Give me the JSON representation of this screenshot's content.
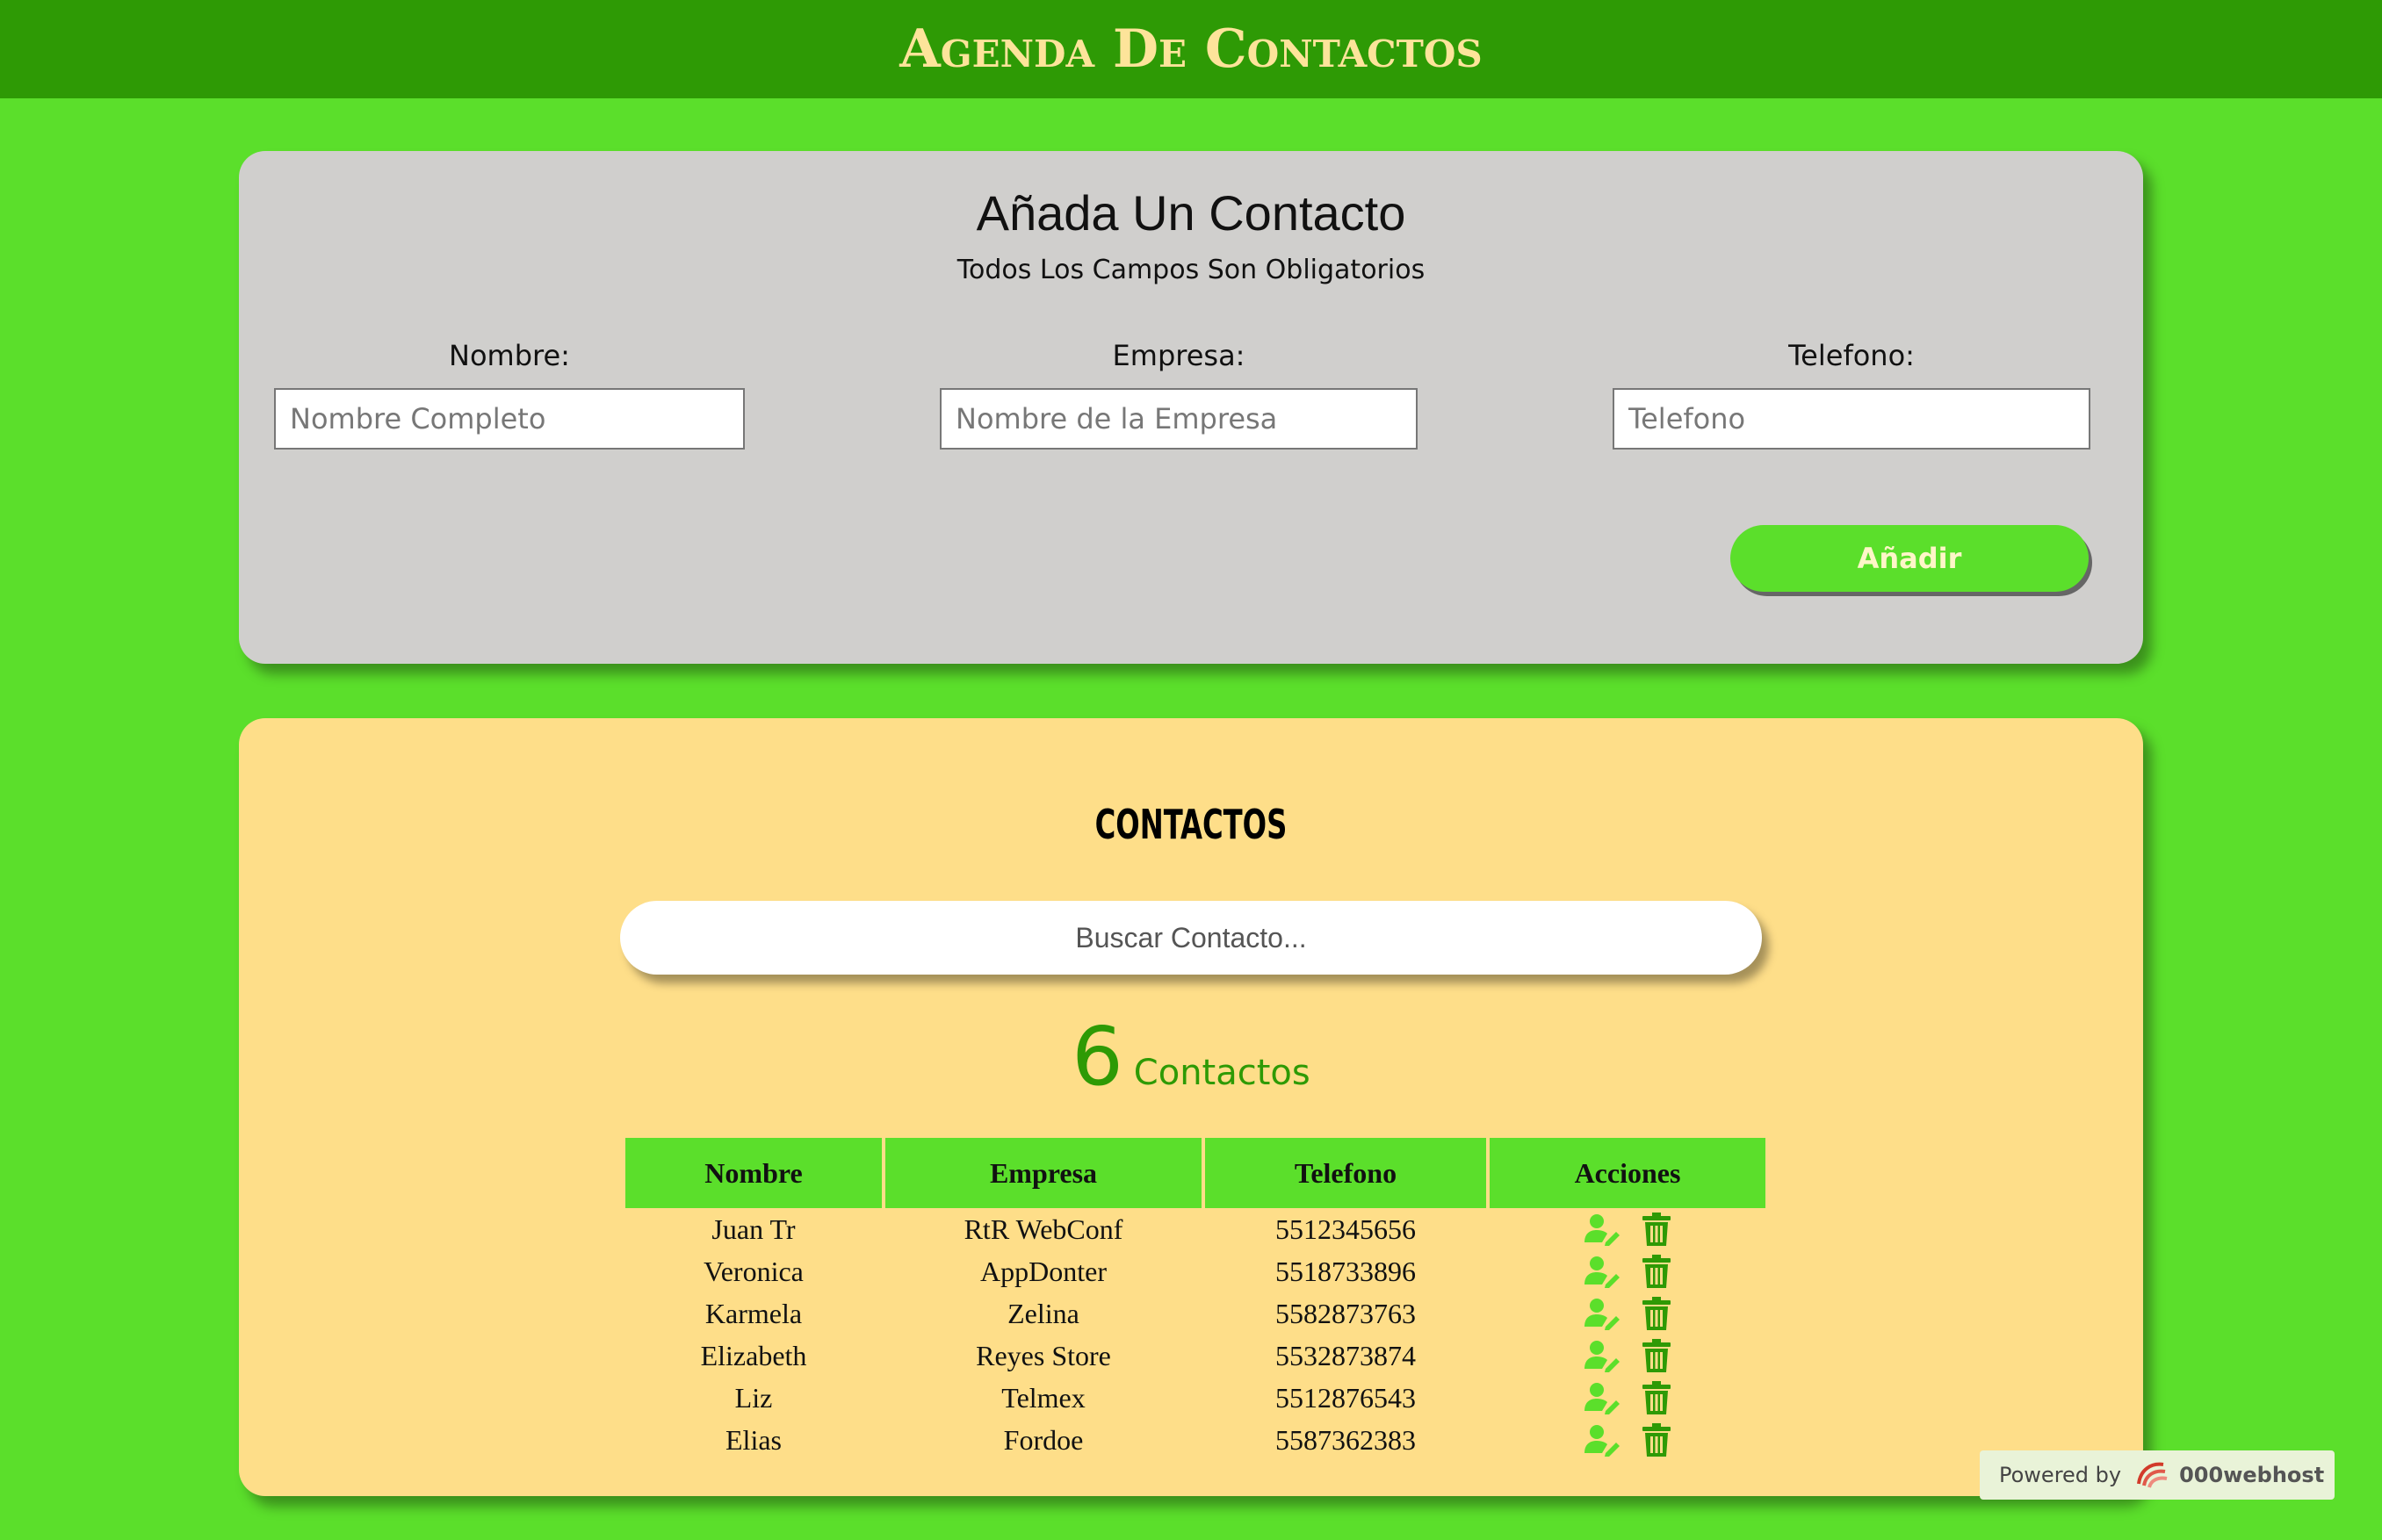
{
  "header": {
    "title": "Agenda De Contactos"
  },
  "form": {
    "title": "Añada Un Contacto",
    "subtitle": "Todos Los Campos Son Obligatorios",
    "fields": [
      {
        "label": "Nombre:",
        "placeholder": "Nombre Completo",
        "value": ""
      },
      {
        "label": "Empresa:",
        "placeholder": "Nombre de la Empresa",
        "value": ""
      },
      {
        "label": "Telefono:",
        "placeholder": "Telefono",
        "value": ""
      }
    ],
    "submit_label": "Añadir"
  },
  "contacts": {
    "title": "CONTACTOS",
    "search_placeholder": "Buscar Contacto...",
    "count": "6",
    "count_label": "Contactos",
    "columns": [
      "Nombre",
      "Empresa",
      "Telefono",
      "Acciones"
    ],
    "rows": [
      {
        "nombre": "Juan Tr",
        "empresa": "RtR WebConf",
        "telefono": "5512345656"
      },
      {
        "nombre": "Veronica",
        "empresa": "AppDonter",
        "telefono": "5518733896"
      },
      {
        "nombre": "Karmela",
        "empresa": "Zelina",
        "telefono": "5582873763"
      },
      {
        "nombre": "Elizabeth",
        "empresa": "Reyes Store",
        "telefono": "5532873874"
      },
      {
        "nombre": "Liz",
        "empresa": "Telmex",
        "telefono": "5512876543"
      },
      {
        "nombre": "Elias",
        "empresa": "Fordoe",
        "telefono": "5587362383"
      }
    ],
    "row_actions": [
      "edit-user-icon",
      "trash-icon"
    ]
  },
  "badge": {
    "prefix": "Powered by",
    "brand": "000webhost"
  },
  "colors": {
    "background": "#5bdf2b",
    "header": "#2e9a05",
    "header_text": "#fde49a",
    "form_card": "#d0cfcd",
    "list_card": "#fede89",
    "accent": "#5bdf2b",
    "icon": "#5bdf2b",
    "trash": "#2e9a05"
  }
}
